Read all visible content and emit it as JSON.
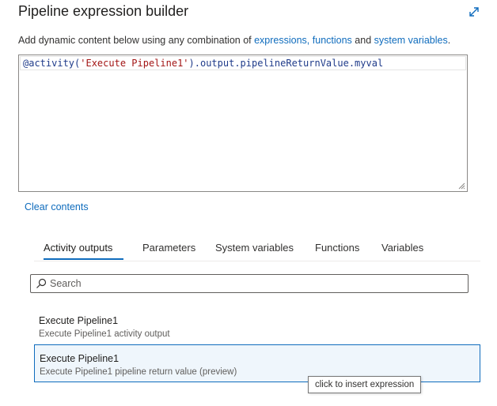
{
  "header": {
    "title": "Pipeline expression builder",
    "expand_icon": "expand-diagonal-icon"
  },
  "description": {
    "prefix": "Add dynamic content below using any combination of ",
    "link_expressions": "expressions,",
    "space": " ",
    "link_functions": "functions",
    "and": " and ",
    "link_system_variables": "system variables",
    "suffix": "."
  },
  "editor": {
    "tokens": {
      "at_fn": "@activity(",
      "string": "'Execute Pipeline1'",
      "rest": ").output.pipelineReturnValue.myval"
    }
  },
  "clear_contents": "Clear contents",
  "tabs": [
    {
      "label": "Activity outputs",
      "active": true
    },
    {
      "label": "Parameters",
      "active": false
    },
    {
      "label": "System variables",
      "active": false
    },
    {
      "label": "Functions",
      "active": false
    },
    {
      "label": "Variables",
      "active": false
    }
  ],
  "search": {
    "placeholder": "Search",
    "value": "",
    "icon": "search-icon"
  },
  "items": [
    {
      "name": "Execute Pipeline1",
      "subtitle": "Execute Pipeline1 activity output",
      "selected": false
    },
    {
      "name": "Execute Pipeline1",
      "subtitle": "Execute Pipeline1 pipeline return value (preview)",
      "selected": true
    }
  ],
  "tooltip": "click to insert expression",
  "colors": {
    "link": "#0f6cbd",
    "selected_bg": "#eff6fc",
    "string": "#a31515",
    "code": "#1f3b8a"
  }
}
